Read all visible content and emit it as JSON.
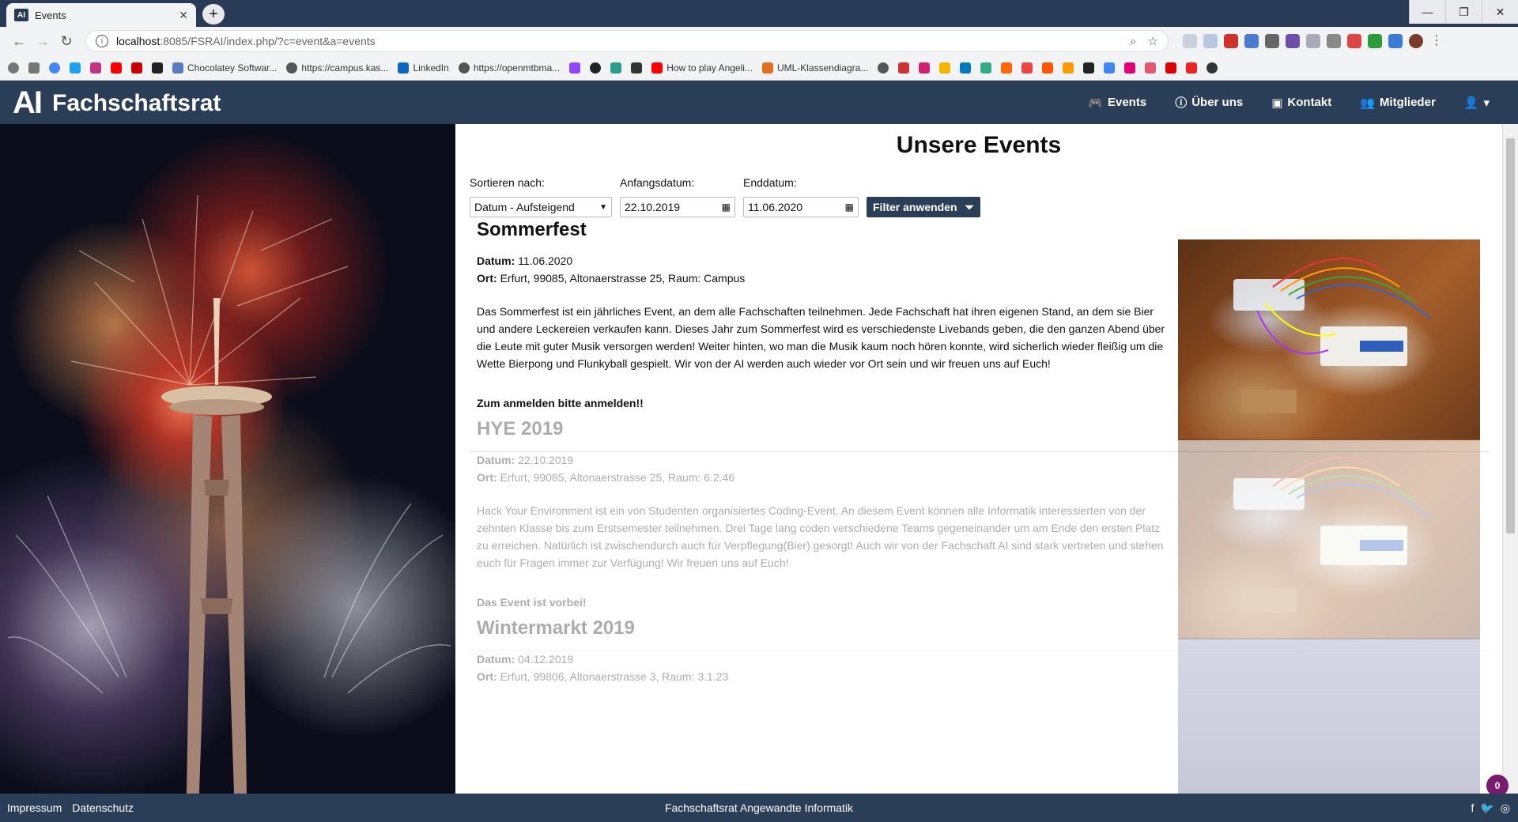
{
  "browser": {
    "tab_title": "Events",
    "tab_favicon_text": "AI",
    "url_host": "localhost",
    "url_rest": ":8085/FSRAI/index.php/?c=event&a=events",
    "bookmarks": [
      "Chocolatey Softwar...",
      "https://campus.kas...",
      "LinkedIn",
      "https://openmtbma...",
      "How to play Angeli...",
      "UML-Klassendiagra..."
    ]
  },
  "site": {
    "brand_logo": "AI",
    "brand_name": "Fachschaftsrat",
    "nav": {
      "events": "Events",
      "about": "Über uns",
      "contact": "Kontakt",
      "members": "Mitglieder"
    },
    "page_title": "Unsere Events",
    "filters": {
      "sort_label": "Sortieren nach:",
      "sort_value": "Datum - Aufsteigend",
      "start_label": "Anfangsdatum:",
      "start_value": "22.10.2019",
      "end_label": "Enddatum:",
      "end_value": "11.06.2020",
      "apply_label": "Filter anwenden"
    },
    "meta_labels": {
      "date": "Datum:",
      "place": "Ort:"
    },
    "events": [
      {
        "title": "Sommerfest",
        "date": "11.06.2020",
        "place": "Erfurt, 99085, Altonaerstrasse 25, Raum: Campus",
        "description": "Das Sommerfest ist ein jährliches Event, an dem alle Fachschaften teilnehmen. Jede Fachschaft hat ihren eigenen Stand, an dem sie Bier und andere Leckereien verkaufen kann. Dieses Jahr zum Sommerfest wird es verschiedenste Livebands geben, die den ganzen Abend über die Leute mit guter Musik versorgen werden! Weiter hinten, wo man die Musik kaum noch hören konnte, wird sicherlich wieder fleißig um die Wette Bierpong und Flunkyball gespielt. Wir von der AI werden auch wieder vor Ort sein und wir freuen uns auf Euch!",
        "note": "Zum anmelden bitte anmelden!!"
      },
      {
        "title": "HYE 2019",
        "date": "22.10.2019",
        "place": "Erfurt, 99085, Altonaerstrasse 25, Raum: 6.2.46",
        "description": "Hack Your Environment ist ein von Studenten organisiertes Coding-Event. An diesem Event können alle Informatik interessierten von der zehnten Klasse bis zum Erstsemester teilnehmen. Drei Tage lang coden verschiedene Teams gegeneinander um am Ende den ersten Platz zu erreichen. Natürlich ist zwischendurch auch für Verpflegung(Bier) gesorgt! Auch wir von der Fachschaft AI sind stark vertreten und stehen euch für Fragen immer zur Verfügung! Wir freuen uns auf Euch!",
        "note": "Das Event ist vorbei!"
      },
      {
        "title": "Wintermarkt 2019",
        "date": "04.12.2019",
        "place": "Erfurt, 99806, Altonaerstrasse 3, Raum: 3.1.23",
        "description": "",
        "note": ""
      }
    ],
    "footer": {
      "impressum": "Impressum",
      "datenschutz": "Datenschutz",
      "center": "Fachschaftsrat Angewandte Informatik"
    },
    "badge_count": "0"
  }
}
